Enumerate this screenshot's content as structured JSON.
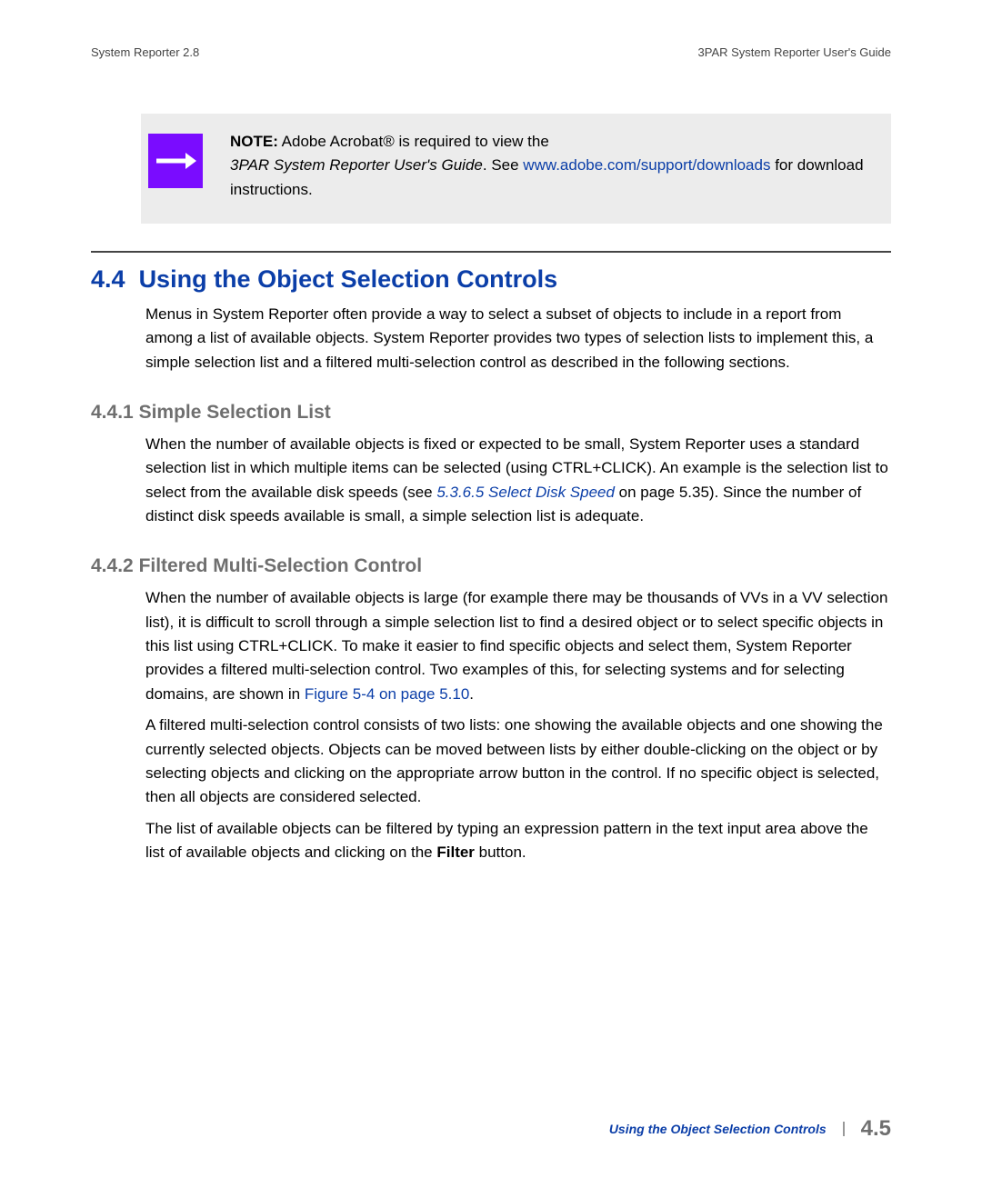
{
  "header": {
    "left": "System Reporter 2.8",
    "right": "3PAR System Reporter User's Guide"
  },
  "note": {
    "label": "NOTE:",
    "text1": " Adobe Acrobat® is required to view the ",
    "italic_title": "3PAR System Reporter User's Guide",
    "text2": ". See ",
    "link": "www.adobe.com/support/downloads",
    "text3": " for download instructions."
  },
  "section": {
    "number": "4.4",
    "title": "Using the Object Selection Controls",
    "intro": "Menus in System Reporter often provide a way to select a subset of objects to include in a report from among a list of available objects. System Reporter provides two types of selection lists to implement this, a simple selection list and a filtered multi-selection control as described in the following sections."
  },
  "sub1": {
    "number": "4.4.1",
    "title": "Simple Selection List",
    "p1a": "When the number of available objects is fixed or expected to be small, System Reporter uses a standard selection list in which multiple items can be selected (using CTRL+CLICK). An example is the selection list to select from the available disk speeds (see ",
    "xref": "5.3.6.5 Select Disk Speed",
    "p1b": " on page 5.35). Since the number of distinct disk speeds available is small, a simple selection list is adequate."
  },
  "sub2": {
    "number": "4.4.2",
    "title": "Filtered Multi-Selection Control",
    "p1a": "When the number of available objects is large (for example there may be thousands of VVs in a VV selection list), it is difficult to scroll through a simple selection list to find a desired object or to select specific objects in this list using CTRL+CLICK. To make it easier to find specific objects and select them, System Reporter provides a filtered multi-selection control. Two examples of this, for selecting systems and for selecting domains, are shown in ",
    "xref": "Figure 5-4 on page 5.10",
    "p1b": ".",
    "p2": "A filtered multi-selection control consists of two lists: one showing the available objects and one showing the currently selected objects. Objects can be moved between lists by either double-clicking on the object or by selecting objects and clicking on the appropriate arrow button in the control. If no specific object is selected, then all objects are considered selected.",
    "p3a": "The list of available objects can be filtered by typing an expression pattern in the text input area above the list of available objects and clicking on the ",
    "p3bold": "Filter",
    "p3b": " button."
  },
  "footer": {
    "title": "Using the Object Selection Controls",
    "page": "4.5"
  }
}
